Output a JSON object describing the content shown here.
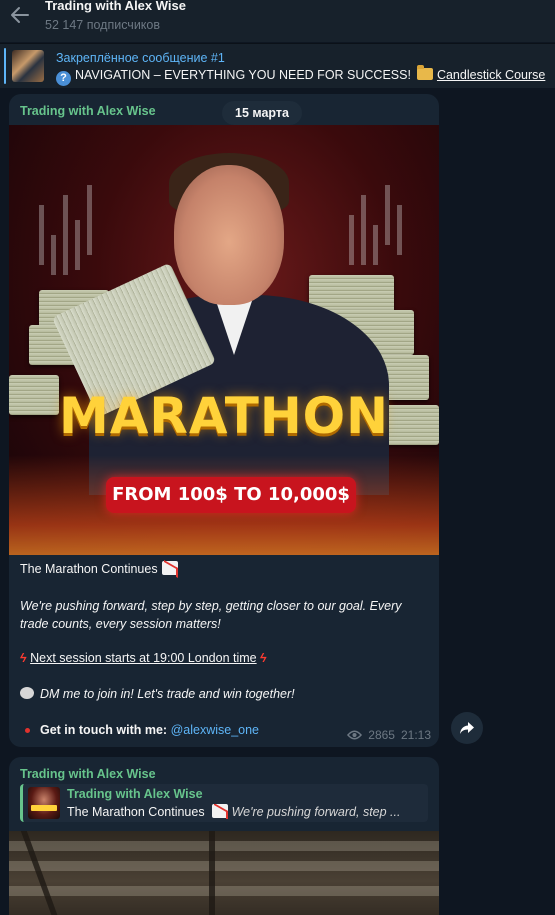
{
  "header": {
    "title": "Trading with Alex Wise",
    "subscribers": "52 147 подписчиков"
  },
  "pinned": {
    "title": "Закреплённое сообщение #1",
    "text": "NAVIGATION – EVERYTHING YOU NEED FOR SUCCESS!",
    "link": "Candlestick Course"
  },
  "messages": [
    {
      "sender": "Trading with Alex Wise",
      "date": "15 марта",
      "image": {
        "title": "MARATHON",
        "badge": "FROM 100$ TO 10,000$"
      },
      "title": "The Marathon Continues",
      "body": "We're pushing forward, step by step, getting closer to our goal. Every trade counts, every session matters!",
      "session": "Next session starts at 19:00 London time",
      "dm": "DM me to join in! Let's trade and win together!",
      "contact_label": "Get in touch with me:",
      "contact_handle": "@alexwise_one",
      "views": "2865",
      "time": "21:13"
    },
    {
      "sender": "Trading with Alex Wise",
      "reply_sender": "Trading with Alex Wise",
      "reply_title": "The Marathon Continues",
      "reply_snippet": "We're pushing forward, step ...",
      "reply_thumb_text": "MARATHON"
    }
  ],
  "colors": {
    "background": "#0e1621",
    "header_bg": "#17212b",
    "bubble_bg": "#182533",
    "accent_blue": "#5eb5f7",
    "sender_green": "#67c48c",
    "muted": "#6d7883"
  },
  "icons": {
    "back": "back-arrow-icon",
    "question": "question-icon",
    "folder": "folder-icon",
    "views": "eye-icon",
    "forward": "forward-share-icon"
  }
}
